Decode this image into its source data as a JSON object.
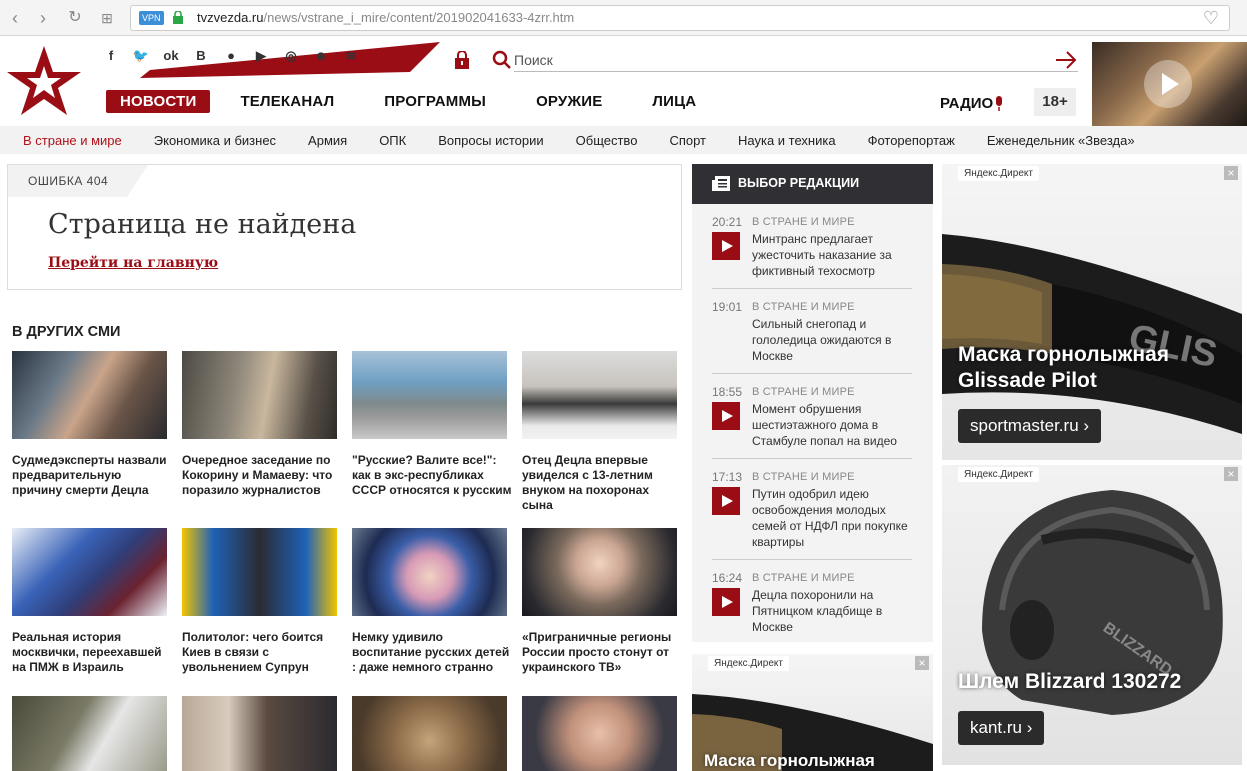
{
  "browser": {
    "vpn_label": "VPN",
    "url_host": "tvzvezda.ru",
    "url_path": "/news/vstrane_i_mire/content/201902041633-4zrr.htm"
  },
  "header": {
    "social_icons": [
      "facebook-icon",
      "twitter-icon",
      "odnoklassniki-icon",
      "vk-icon",
      "messenger-icon",
      "youtube-icon",
      "instagram-icon",
      "moimir-icon",
      "rss-icon"
    ],
    "social_glyphs": [
      "f",
      "🐦",
      "ok",
      "B",
      "●",
      "▶",
      "◎",
      "☻",
      "≋"
    ],
    "search_placeholder": "Поиск",
    "nav": [
      "НОВОСТИ",
      "ТЕЛЕКАНАЛ",
      "ПРОГРАММЫ",
      "ОРУЖИЕ",
      "ЛИЦА"
    ],
    "radio": "РАДИО",
    "age": "18+"
  },
  "subnav": [
    "В стране и мире",
    "Экономика и бизнес",
    "Армия",
    "ОПК",
    "Вопросы истории",
    "Общество",
    "Спорт",
    "Наука и техника",
    "Фоторепортаж",
    "Еженедельник «Звезда»"
  ],
  "error": {
    "tag": "ОШИБКА 404",
    "title": "Страница не найдена",
    "link": "Перейти на главную"
  },
  "other_media": {
    "title": "В ДРУГИХ СМИ",
    "items": [
      "Судмедэксперты назвали предварительную причину смерти Децла",
      "Очередное заседание по Кокорину и Мамаеву: что поразило журналистов",
      "\"Русские? Валите все!\": как в экс-республиках СССР относятся к русским",
      "Отец Децла впервые увиделся с 13-летним внуком на похоронах сына",
      "Реальная история москвички, переехавшей на ПМЖ в Израиль",
      "Политолог: чего боится Киев в связи с увольнением Супрун",
      "Немку удивило воспитание русских детей : даже немного странно",
      "«Приграничные регионы России просто стонут от украинского ТВ»"
    ]
  },
  "editors": {
    "title": "ВЫБОР РЕДАКЦИИ",
    "items": [
      {
        "time": "20:21",
        "rubric": "В СТРАНЕ И МИРЕ",
        "text": "Минтранс предлагает ужесточить наказание за фиктивный техосмотр"
      },
      {
        "time": "19:01",
        "rubric": "В СТРАНЕ И МИРЕ",
        "text": "Сильный снегопад и гололедица ожидаются в Москве"
      },
      {
        "time": "18:55",
        "rubric": "В СТРАНЕ И МИРЕ",
        "text": "Момент обрушения шестиэтажного дома в Стамбуле попал на видео"
      },
      {
        "time": "17:13",
        "rubric": "В СТРАНЕ И МИРЕ",
        "text": "Путин одобрил идею освобождения молодых семей от НДФЛ при покупке квартиры"
      },
      {
        "time": "16:24",
        "rubric": "В СТРАНЕ И МИРЕ",
        "text": "Децла похоронили на Пятницком кладбище в Москве"
      }
    ]
  },
  "ads": {
    "label": "Яндекс.Директ",
    "close": "×",
    "ad1_title": "Маска горнолыжная Glissade Pilot",
    "ad1_button": "sportmaster.ru ›",
    "ad1_brand": "GLIS",
    "ad2_title": "Шлем Blizzard 130272",
    "ad2_button": "kant.ru ›",
    "ad2_brand": "BLIZZARD",
    "ad3_title": "Маска горнолыжная"
  },
  "colors": {
    "brand_red": "#9a0d15",
    "dark_panel": "#2f2f34"
  }
}
